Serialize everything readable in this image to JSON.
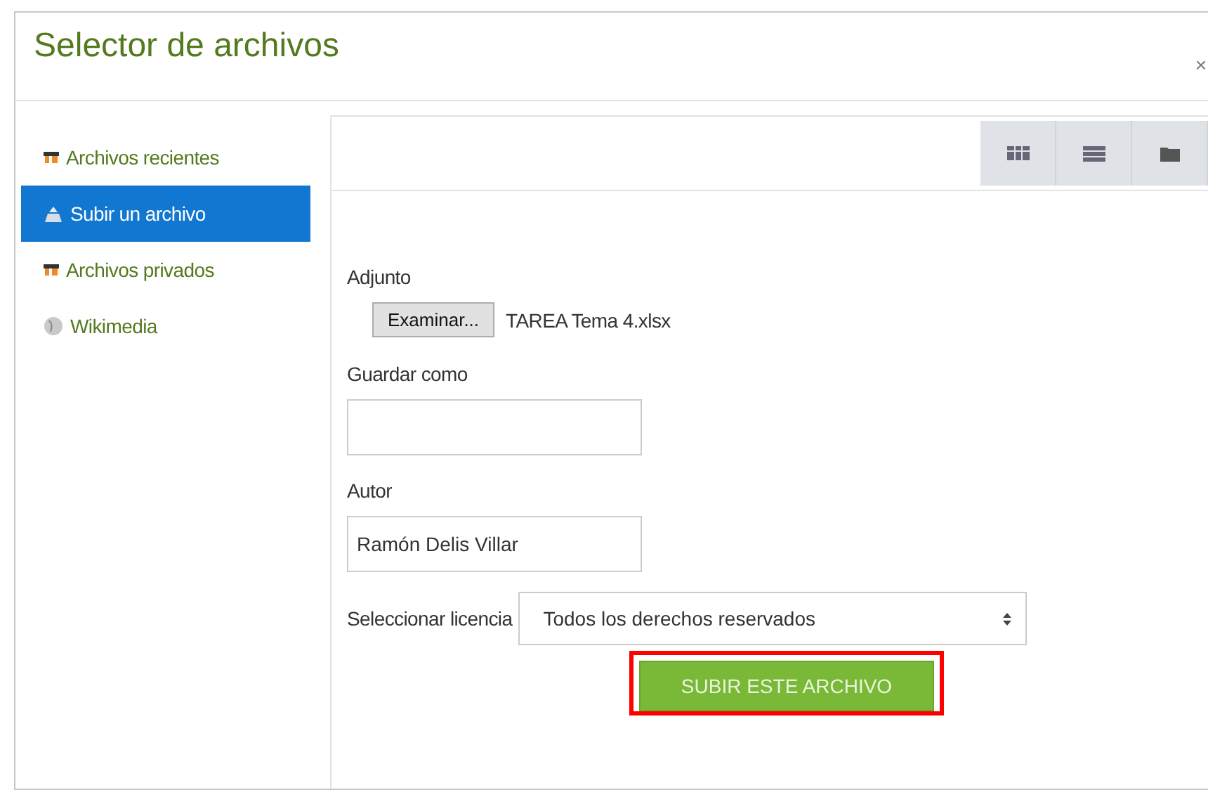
{
  "window": {
    "title": "Selector de archivos",
    "close": "×"
  },
  "sidebar": {
    "items": [
      {
        "label": "Archivos recientes",
        "kind": "recent",
        "selected": false
      },
      {
        "label": "Subir un archivo",
        "kind": "upload",
        "selected": true
      },
      {
        "label": "Archivos privados",
        "kind": "private",
        "selected": false
      },
      {
        "label": "Wikimedia",
        "kind": "wikimedia",
        "selected": false
      }
    ]
  },
  "toolbar": {
    "views": [
      {
        "kind": "icons"
      },
      {
        "kind": "list"
      },
      {
        "kind": "tree"
      }
    ]
  },
  "form": {
    "attachment": {
      "label": "Adjunto",
      "button": "Examinar...",
      "file": "TAREA Tema 4.xlsx"
    },
    "save_as": {
      "label": "Guardar como"
    },
    "author": {
      "label": "Autor",
      "value": "Ramón Delis Villar"
    },
    "license": {
      "label": "Seleccionar licencia",
      "value": "Todos los derechos reservados"
    },
    "submit": {
      "label": "SUBIR ESTE ARCHIVO",
      "highlighted": true
    }
  }
}
